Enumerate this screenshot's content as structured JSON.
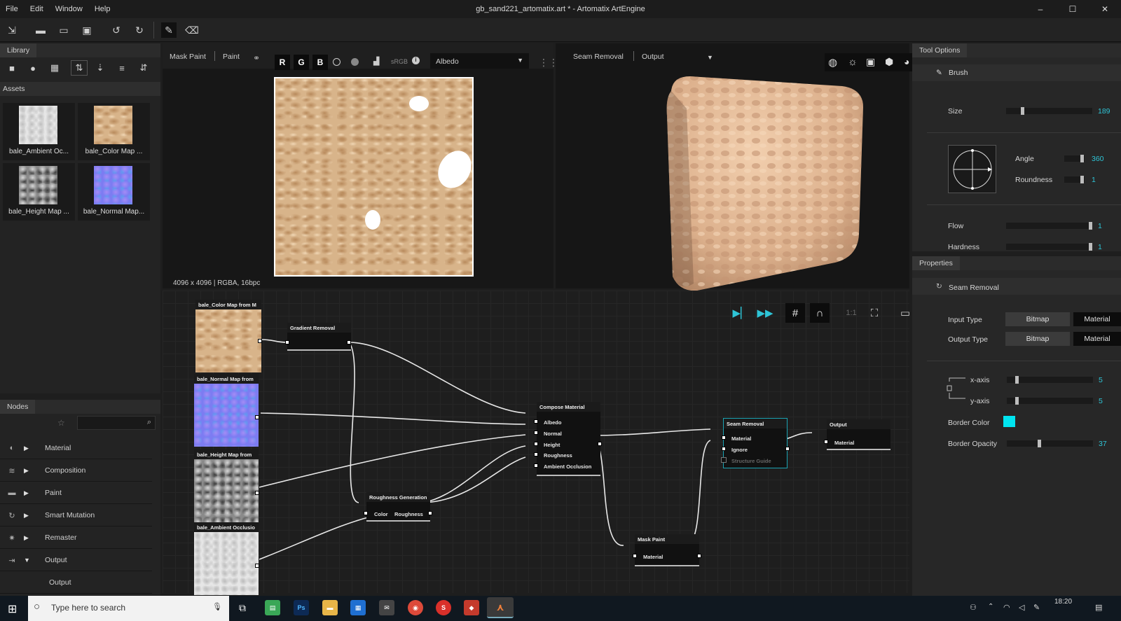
{
  "window": {
    "title": "gb_sand221_artomatix.art * - Artomatix ArtEngine",
    "minimize": "–",
    "maximize": "☐",
    "close": "✕"
  },
  "menu": [
    "File",
    "Edit",
    "Window",
    "Help"
  ],
  "library": {
    "tab": "Library",
    "assets_label": "Assets",
    "assets": [
      {
        "label": "bale_Ambient Oc...",
        "kind": "ao"
      },
      {
        "label": "bale_Color Map ...",
        "kind": "color"
      },
      {
        "label": "bale_Height Map ...",
        "kind": "height"
      },
      {
        "label": "bale_Normal Map...",
        "kind": "normal"
      }
    ]
  },
  "nodes_panel": {
    "tab": "Nodes",
    "items": [
      {
        "label": "Material",
        "icon": "sphere-icon",
        "expanded": false
      },
      {
        "label": "Composition",
        "icon": "layers-icon",
        "expanded": false
      },
      {
        "label": "Paint",
        "icon": "paint-icon",
        "expanded": false
      },
      {
        "label": "Smart Mutation",
        "icon": "refresh-icon",
        "expanded": false
      },
      {
        "label": "Remaster",
        "icon": "remaster-icon",
        "expanded": false
      },
      {
        "label": "Output",
        "icon": "output-icon",
        "expanded": true
      }
    ],
    "sub_item": "Output"
  },
  "view2d": {
    "tabs": [
      "Mask Paint",
      "Paint"
    ],
    "channels": [
      "R",
      "G",
      "B"
    ],
    "srgb": "sRGB",
    "map_select": "Albedo",
    "info": "4096 x 4096 | RGBA, 16bpc"
  },
  "view3d": {
    "tabs": [
      "Seam Removal",
      "Output"
    ]
  },
  "graph": {
    "inputs": [
      {
        "title": "bale_Color Map from M",
        "kind": "color"
      },
      {
        "title": "bale_Normal Map from",
        "kind": "normal"
      },
      {
        "title": "bale_Height Map from",
        "kind": "height"
      },
      {
        "title": "bale_Ambient Occlusio",
        "kind": "ao"
      }
    ],
    "gradient_removal": "Gradient Removal",
    "compose": {
      "title": "Compose Material",
      "ports": [
        "Albedo",
        "Normal",
        "Height",
        "Roughness",
        "Ambient Occlusion"
      ]
    },
    "roughness_gen": {
      "title": "Roughness Generation",
      "in": "Color",
      "out": "Roughness"
    },
    "seam_removal": {
      "title": "Seam Removal",
      "ports": [
        "Material",
        "Ignore",
        "Structure Guide"
      ]
    },
    "mask_paint": {
      "title": "Mask Paint",
      "port": "Material"
    },
    "output": {
      "title": "Output",
      "port": "Material"
    },
    "zoom": "1:1"
  },
  "tool_options": {
    "tab": "Tool Options",
    "tool": "Brush",
    "size": {
      "label": "Size",
      "value": "189",
      "fraction": 0.18
    },
    "angle": {
      "label": "Angle",
      "value": "360",
      "fraction": 0.95
    },
    "roundness": {
      "label": "Roundness",
      "value": "1",
      "fraction": 0.95
    },
    "flow": {
      "label": "Flow",
      "value": "1",
      "fraction": 1.0
    },
    "hardness": {
      "label": "Hardness",
      "value": "1",
      "fraction": 1.0
    }
  },
  "properties": {
    "tab": "Properties",
    "node": "Seam Removal",
    "input_type": {
      "label": "Input Type",
      "options": [
        "Bitmap",
        "Material"
      ]
    },
    "output_type": {
      "label": "Output Type",
      "options": [
        "Bitmap",
        "Material"
      ]
    },
    "x_axis": {
      "label": "x-axis",
      "value": "5",
      "fraction": 0.1
    },
    "y_axis": {
      "label": "y-axis",
      "value": "5",
      "fraction": 0.1
    },
    "border_color": {
      "label": "Border Color",
      "color": "#00e5f0"
    },
    "border_opacity": {
      "label": "Border Opacity",
      "value": "37",
      "fraction": 0.37
    }
  },
  "taskbar": {
    "search_placeholder": "Type here to search",
    "time": "18:20"
  },
  "colors": {
    "accent": "#2ec4d6",
    "panel": "#262626",
    "dark": "#171717"
  }
}
